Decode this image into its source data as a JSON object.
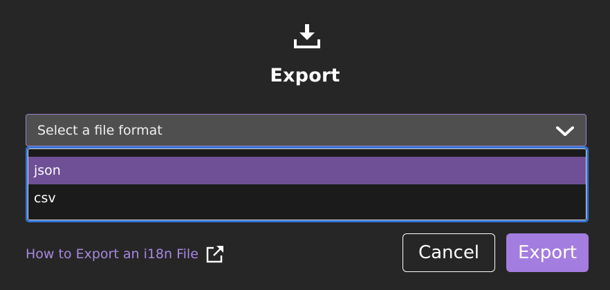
{
  "dialog": {
    "icon": "download-icon",
    "title": "Export"
  },
  "format_select": {
    "value": "Select a file format",
    "icon": "chevron-down-icon",
    "options": [
      {
        "label": "json",
        "selected": true
      },
      {
        "label": "csv",
        "selected": false
      }
    ]
  },
  "help_link": {
    "label": "How to Export an i18n File",
    "icon": "external-link-icon"
  },
  "buttons": {
    "cancel_label": "Cancel",
    "export_label": "Export"
  },
  "colors": {
    "background": "#262626",
    "accent": "#a47de0",
    "selected_option": "#6f5096",
    "focus_ring": "#3575d6"
  }
}
